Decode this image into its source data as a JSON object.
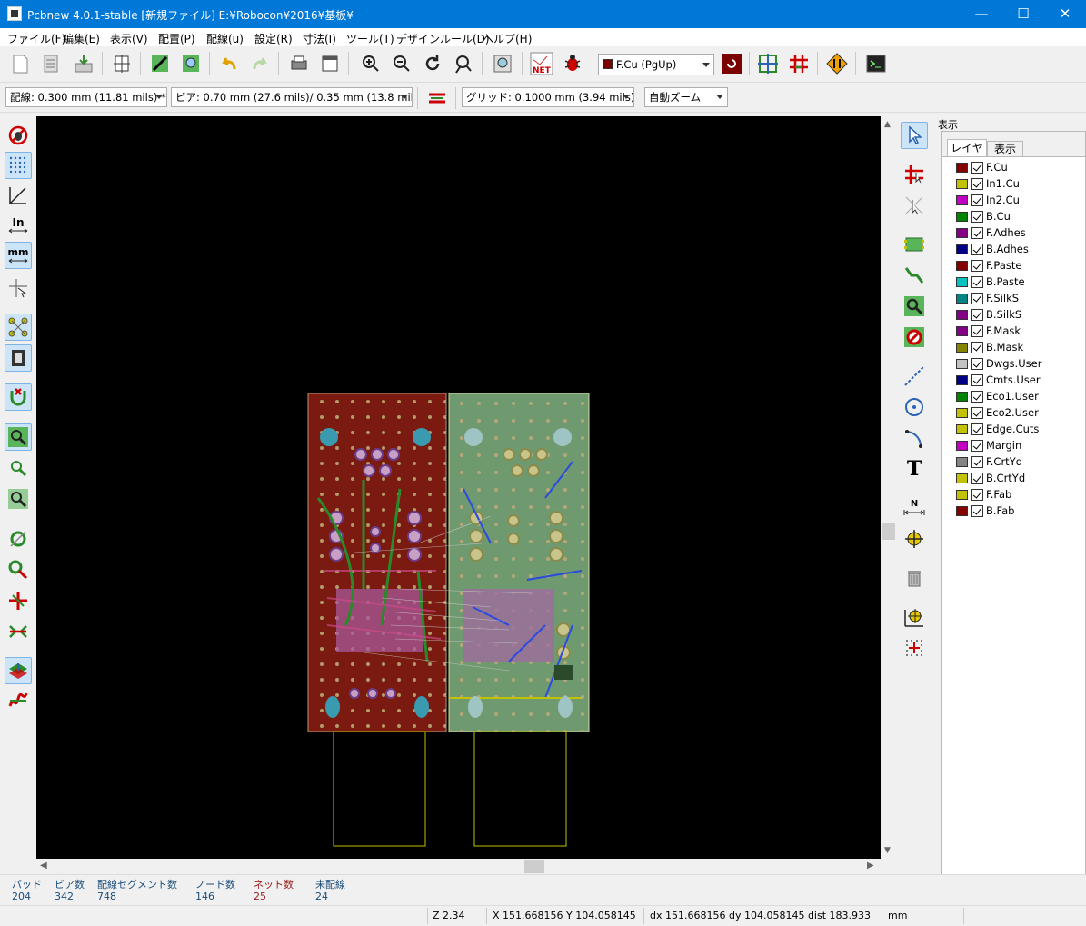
{
  "window": {
    "title": "Pcbnew 4.0.1-stable  [新規ファイル] E:¥Robocon¥2016¥基板¥",
    "minimize": "—",
    "maximize": "☐",
    "close": "✕"
  },
  "menu": {
    "items": [
      "ファイル(F)",
      "編集(E)",
      "表示(V)",
      "配置(P)",
      "配線(u)",
      "設定(R)",
      "寸法(I)",
      "ツール(T)",
      "デザインルール(D)",
      "ヘルプ(H)"
    ]
  },
  "toolbar": {
    "layer_select": "F.Cu (PgUp)",
    "layer_color": "#7a0000",
    "net_label": "NET"
  },
  "toolbar2": {
    "track_width": "配線: 0.300 mm (11.81 mils) *",
    "via_size": "ビア: 0.70 mm (27.6 mils)/ 0.35 mm (13.8 mils) *",
    "grid": "グリッド: 0.1000 mm (3.94 mils)",
    "zoom": "自動ズーム"
  },
  "left_toolbar": {
    "in_label": "In",
    "mm_label": "mm"
  },
  "right_toolbar": {
    "text_tool": "T",
    "dim_label": "N"
  },
  "panel": {
    "header": "表示",
    "tabs": [
      "レイヤ",
      "表示"
    ],
    "layers": [
      {
        "name": "F.Cu",
        "color": "#840000"
      },
      {
        "name": "In1.Cu",
        "color": "#c2c200"
      },
      {
        "name": "In2.Cu",
        "color": "#c200c2"
      },
      {
        "name": "B.Cu",
        "color": "#008400"
      },
      {
        "name": "F.Adhes",
        "color": "#840084"
      },
      {
        "name": "B.Adhes",
        "color": "#000084"
      },
      {
        "name": "F.Paste",
        "color": "#840000"
      },
      {
        "name": "B.Paste",
        "color": "#00c2c2"
      },
      {
        "name": "F.SilkS",
        "color": "#008484"
      },
      {
        "name": "B.SilkS",
        "color": "#840084"
      },
      {
        "name": "F.Mask",
        "color": "#840084"
      },
      {
        "name": "B.Mask",
        "color": "#848400"
      },
      {
        "name": "Dwgs.User",
        "color": "#c2c2c2"
      },
      {
        "name": "Cmts.User",
        "color": "#000084"
      },
      {
        "name": "Eco1.User",
        "color": "#008400"
      },
      {
        "name": "Eco2.User",
        "color": "#c2c200"
      },
      {
        "name": "Edge.Cuts",
        "color": "#c2c200"
      },
      {
        "name": "Margin",
        "color": "#c200c2"
      },
      {
        "name": "F.CrtYd",
        "color": "#848484"
      },
      {
        "name": "B.CrtYd",
        "color": "#c2c200"
      },
      {
        "name": "F.Fab",
        "color": "#c2c200"
      },
      {
        "name": "B.Fab",
        "color": "#840000"
      }
    ]
  },
  "stats": [
    {
      "label": "パッド",
      "value": "204",
      "color": "#1a4d7a"
    },
    {
      "label": "ビア数",
      "value": "342",
      "color": "#1a4d7a"
    },
    {
      "label": "配線セグメント数",
      "value": "748",
      "color": "#1a4d7a"
    },
    {
      "label": "ノード数",
      "value": "146",
      "color": "#1a4d7a"
    },
    {
      "label": "ネット数",
      "value": "25",
      "color": "#9b1c1c"
    },
    {
      "label": "未配線",
      "value": "24",
      "color": "#1a4d7a"
    }
  ],
  "status": {
    "zoom": "Z 2.34",
    "cursor": "X 151.668156  Y 104.058145",
    "delta": "dx 151.668156  dy 104.058145  dist 183.933",
    "units": "mm"
  }
}
